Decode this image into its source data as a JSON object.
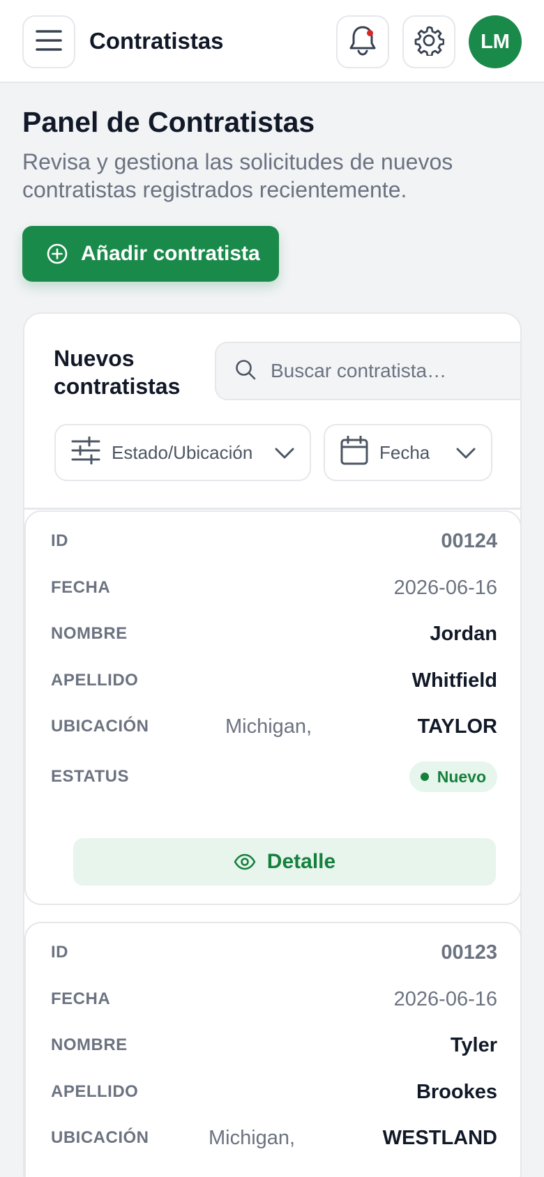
{
  "header": {
    "title": "Contratistas",
    "avatar_initials": "LM",
    "icons": [
      "menu-icon",
      "bell-icon",
      "gear-icon"
    ]
  },
  "page": {
    "title": "Panel de Contratistas",
    "subtitle": "Revisa y gestiona las solicitudes de nuevos contratistas registrados recientemente.",
    "add_button": "Añadir contratista"
  },
  "panel": {
    "title": "Nuevos contratistas",
    "search_placeholder": "Buscar contratista…",
    "filter_state": "Estado/Ubicación",
    "filter_date": "Fecha"
  },
  "labels": {
    "id": "ID",
    "date": "FECHA",
    "first_name": "NOMBRE",
    "last_name": "APELLIDO",
    "location": "UBICACIÓN",
    "status": "ESTATUS",
    "detail": "Detalle"
  },
  "contractors": [
    {
      "id": "00124",
      "date": "2026-06-16",
      "first_name": "Jordan",
      "last_name": "Whitfield",
      "state": "Michigan,",
      "city": "TAYLOR",
      "status": "Nuevo"
    },
    {
      "id": "00123",
      "date": "2026-06-16",
      "first_name": "Tyler",
      "last_name": "Brookes",
      "state": "Michigan,",
      "city": "WESTLAND"
    }
  ],
  "colors": {
    "primary": "#1a8a4a",
    "status_new_bg": "#e6f6ec",
    "status_new_fg": "#15803d",
    "notification_dot": "#dc2626"
  }
}
